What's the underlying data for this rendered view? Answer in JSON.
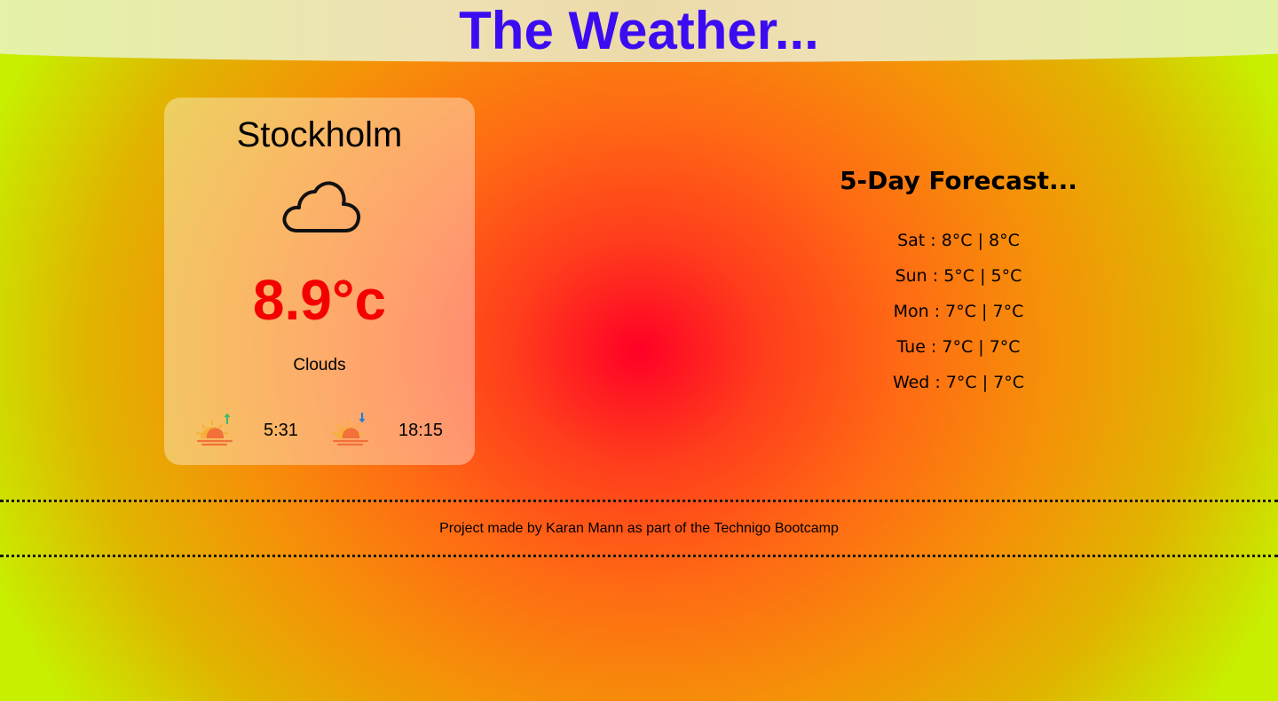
{
  "header": {
    "title": "The Weather..."
  },
  "current": {
    "city": "Stockholm",
    "icon": "cloud-icon",
    "temperature": "8.9°c",
    "description": "Clouds",
    "sunrise": {
      "icon": "sunrise-icon",
      "time": "5:31"
    },
    "sunset": {
      "icon": "sunset-icon",
      "time": "18:15"
    }
  },
  "forecast": {
    "title": "5-Day Forecast...",
    "days": [
      {
        "text": "Sat : 8°C | 8°C"
      },
      {
        "text": "Sun : 5°C | 5°C"
      },
      {
        "text": "Mon : 7°C | 7°C"
      },
      {
        "text": "Tue : 7°C | 7°C"
      },
      {
        "text": "Wed : 7°C | 7°C"
      }
    ]
  },
  "footer": {
    "text": "Project made by Karan Mann as part of the Technigo Bootcamp"
  },
  "colors": {
    "title": "#3b0cf2",
    "temperature": "#f40000",
    "background_center": "#ff0026",
    "background_edge": "#c8ee00"
  }
}
